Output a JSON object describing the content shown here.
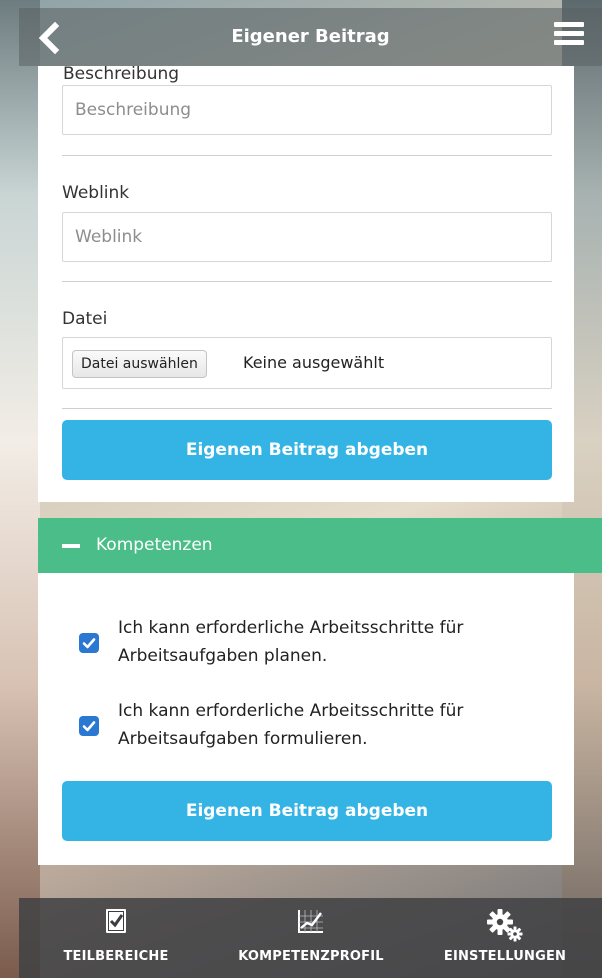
{
  "header": {
    "title": "Eigener Beitrag"
  },
  "form": {
    "description_label": "Beschreibung",
    "description_placeholder": "Beschreibung",
    "weblink_label": "Weblink",
    "weblink_placeholder": "Weblink",
    "file_label": "Datei",
    "file_button_label": "Datei auswählen",
    "file_status": "Keine ausgewählt",
    "submit_label": "Eigenen Beitrag abgeben"
  },
  "competencies": {
    "title": "Kompetenzen",
    "items": [
      {
        "label": "Ich kann erforderliche Arbeitsschritte für Arbeitsaufgaben planen.",
        "checked": true
      },
      {
        "label": "Ich kann erforderliche Arbeitsschritte für Arbeitsaufgaben formulieren.",
        "checked": true
      }
    ],
    "submit_label": "Eigenen Beitrag abgeben"
  },
  "bottom_nav": {
    "items": [
      {
        "label": "TEILBEREICHE",
        "icon": "checklist-icon"
      },
      {
        "label": "KOMPETENZPROFIL",
        "icon": "chart-icon"
      },
      {
        "label": "EINSTELLUNGEN",
        "icon": "gears-icon"
      }
    ]
  },
  "colors": {
    "accent_blue": "#33b4e5",
    "accent_green": "#4abd88",
    "checkbox_blue": "#2a78d2"
  }
}
